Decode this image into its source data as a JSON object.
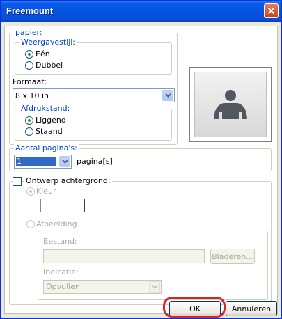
{
  "window": {
    "title": "Freemount"
  },
  "papier": {
    "legend": "papier:",
    "weergave": {
      "legend": "Weergavestijl:",
      "options": [
        "Eén",
        "Dubbel"
      ],
      "selected": 0
    },
    "formaat": {
      "label": "Formaat:",
      "value": "8 x 10 in"
    },
    "afdruk": {
      "legend": "Afdrukstand:",
      "options": [
        "Liggend",
        "Staand"
      ],
      "selected": 0
    }
  },
  "pages": {
    "legend": "Aantal pagina's:",
    "value": "1",
    "suffix": "pagina[s]"
  },
  "background": {
    "check_label": "Ontwerp achtergrond:",
    "checked": false,
    "kleur_label": "Kleur",
    "afbeelding_label": "Afbeelding",
    "bestand_label": "Bestand:",
    "bestand_value": "",
    "browse_label": "Bladeren...",
    "indicatie_label": "Indicatie:",
    "indicatie_value": "Opvullen"
  },
  "footer": {
    "ok_label": "OK",
    "cancel_label": "Annuleren"
  },
  "colors": {
    "title_bar": "#0554e3",
    "accent_text": "#0046d5",
    "highlight_ring": "#d8242a",
    "dialog_bg": "#ece9d8"
  },
  "icons": {
    "close": "close-icon",
    "preview": "person-silhouette-icon",
    "dropdown": "chevron-down-icon"
  }
}
